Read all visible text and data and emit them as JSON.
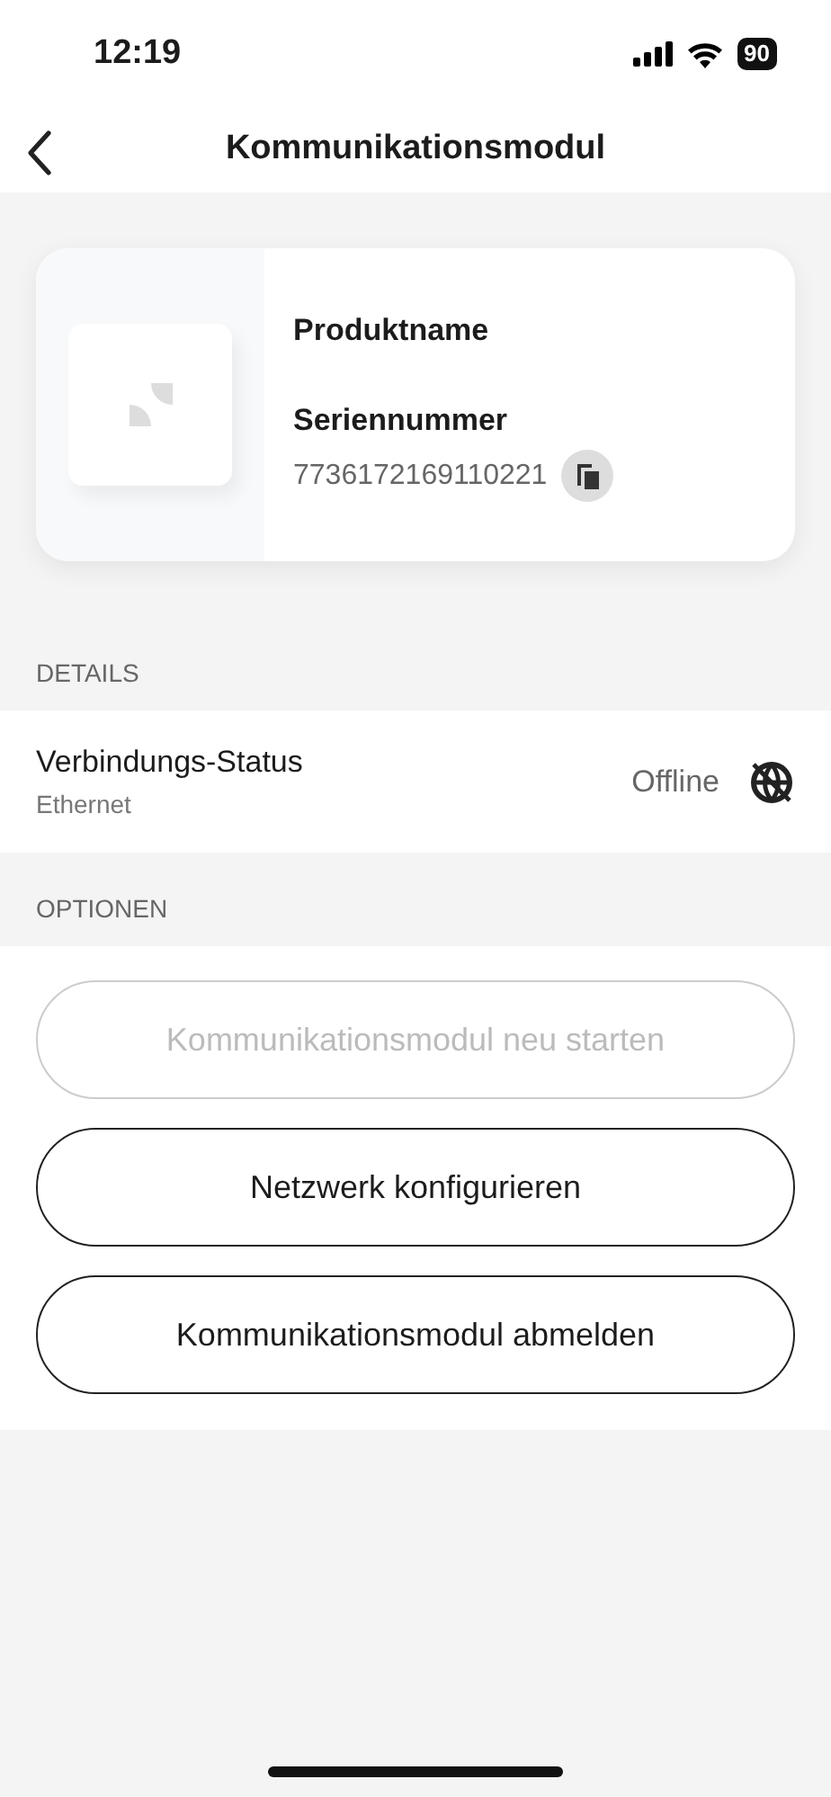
{
  "status_bar": {
    "time": "12:19",
    "battery": "90"
  },
  "header": {
    "title": "Kommunikationsmodul"
  },
  "product": {
    "name": "Produktname",
    "serial_label": "Seriennummer",
    "serial": "7736172169110221"
  },
  "details": {
    "heading": "DETAILS",
    "rows": [
      {
        "label": "Verbindungs-Status",
        "sublabel": "Ethernet",
        "value": "Offline"
      }
    ]
  },
  "options": {
    "heading": "OPTIONEN",
    "buttons": [
      {
        "label": "Kommunikationsmodul neu starten",
        "disabled": true
      },
      {
        "label": "Netzwerk konfigurieren",
        "disabled": false
      },
      {
        "label": "Kommunikationsmodul abmelden",
        "disabled": false
      }
    ]
  }
}
